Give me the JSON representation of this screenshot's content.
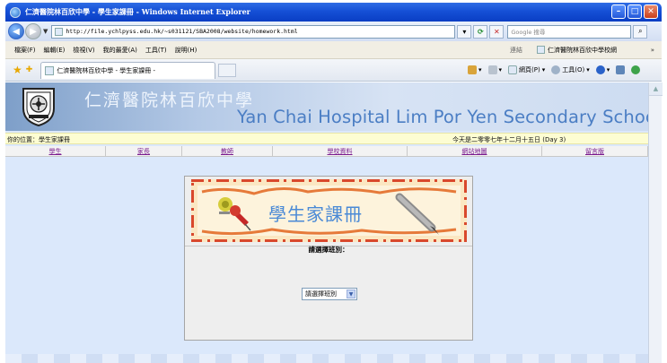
{
  "window": {
    "title": "仁濟醫院林百欣中學 - 學生家課冊 - Windows Internet Explorer",
    "controls": [
      "minimize",
      "maximize",
      "close"
    ]
  },
  "address_bar": {
    "url": "http://file.ychlpyss.edu.hk/~s031121/SBA2008/website/homework.html",
    "search_placeholder": "Google 搜尋"
  },
  "menu": {
    "items": [
      "檔案(F)",
      "編輯(E)",
      "檢視(V)",
      "我的最愛(A)",
      "工具(T)",
      "說明(H)"
    ],
    "links_label": "連結",
    "link_item": "仁濟醫院林百欣中學校網",
    "chevron": "»"
  },
  "tabs": {
    "active_tab": "仁濟醫院林百欣中學 - 學生家課冊 -",
    "commands": [
      "網頁(P)",
      "工具(O)"
    ]
  },
  "site": {
    "school_name_cn": "仁濟醫院林百欣中學",
    "school_name_en": "Yan Chai Hospital Lim Por Yen Secondary School",
    "location": "你的位置：學生家課冊",
    "date": "今天是二零零七年十二月十五日 (Day 3)",
    "nav": [
      "學生",
      "家長",
      "教師",
      "學校資料",
      "網站地圖",
      "留言版"
    ]
  },
  "homework_panel": {
    "banner_title": "學生家課冊",
    "prompt": "請選擇班別：",
    "class_select": {
      "selected": "請選擇班別"
    }
  },
  "colors": {
    "title_bar": "#1550d6",
    "page_background": "#dbe8fb",
    "english_name": "#4b7ec4",
    "nav_link": "#7a1a8e",
    "location_bar": "#fdfdd2"
  }
}
